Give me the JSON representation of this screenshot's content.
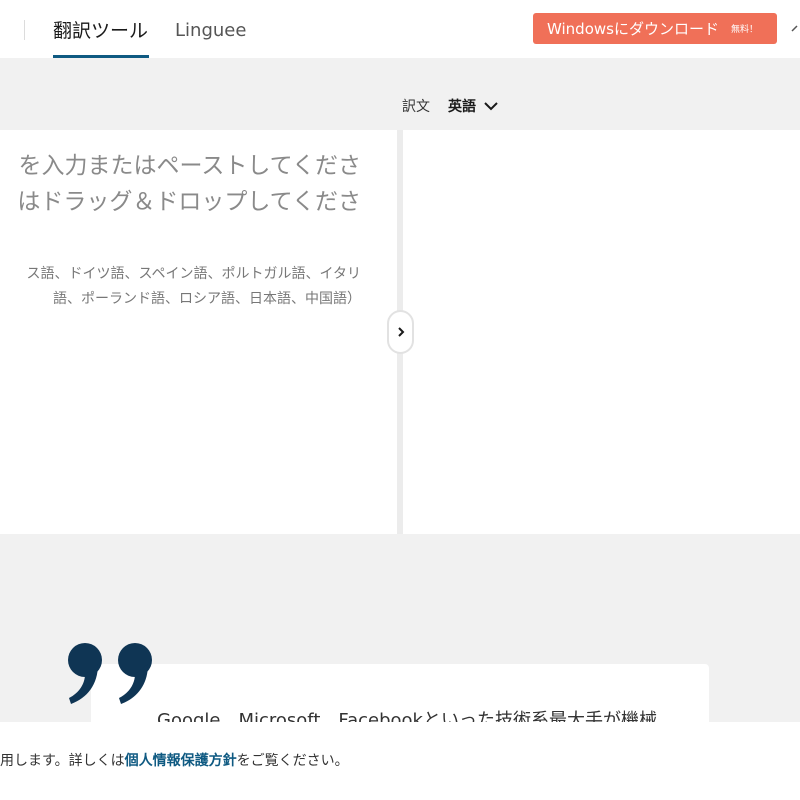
{
  "header": {
    "tabs": [
      {
        "label": "翻訳ツール",
        "active": true
      },
      {
        "label": "Linguee",
        "active": false
      }
    ],
    "download_button": {
      "label": "Windowsにダウンロード",
      "badge": "無料！"
    },
    "colors": {
      "accent": "#0f5a82",
      "download_bg": "#f07058"
    }
  },
  "translator": {
    "target_label": "訳文",
    "target_language": "英語",
    "source_placeholder": [
      "を入力またはペーストしてくださ",
      "はドラッグ＆ドロップしてくださ"
    ],
    "supported_formats": [
      "ス語、ドイツ語、スペイン語、ポルトガル語、イタリ",
      "語、ポーランド語、ロシア語、日本語、中国語）"
    ],
    "swap_icon": "chevron-right-icon"
  },
  "testimonial": {
    "quote_icon": "quote-mark-icon",
    "text": "Google、Microsoft、Facebookといった技術系最大手が機械"
  },
  "cookie_bar": {
    "text_before": "用します。詳しくは",
    "link_text": "個人情報保護方針",
    "text_after": "をご覧ください。"
  }
}
